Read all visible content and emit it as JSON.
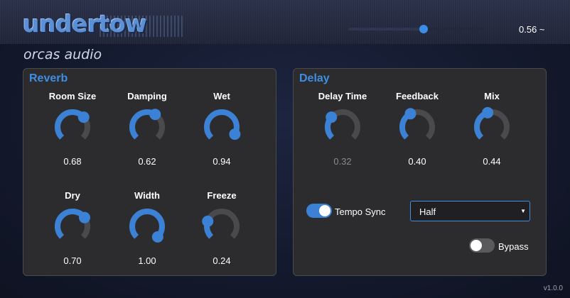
{
  "header": {
    "title": "undertow",
    "subtitle": "orcas audio",
    "master": {
      "value": 0.56,
      "display": "0.56 ~"
    }
  },
  "reverb": {
    "title": "Reverb",
    "knobs": [
      {
        "label": "Room Size",
        "value": 0.68,
        "display": "0.68"
      },
      {
        "label": "Damping",
        "value": 0.62,
        "display": "0.62"
      },
      {
        "label": "Wet",
        "value": 0.94,
        "display": "0.94"
      },
      {
        "label": "Dry",
        "value": 0.7,
        "display": "0.70"
      },
      {
        "label": "Width",
        "value": 1.0,
        "display": "1.00"
      },
      {
        "label": "Freeze",
        "value": 0.24,
        "display": "0.24"
      }
    ]
  },
  "delay": {
    "title": "Delay",
    "knobs": [
      {
        "label": "Delay Time",
        "value": 0.32,
        "display": "0.32",
        "disabled": true
      },
      {
        "label": "Feedback",
        "value": 0.4,
        "display": "0.40"
      },
      {
        "label": "Mix",
        "value": 0.44,
        "display": "0.44"
      }
    ],
    "tempo_sync": {
      "label": "Tempo Sync",
      "on": true
    },
    "division": {
      "value": "Half"
    },
    "bypass": {
      "label": "Bypass",
      "on": false
    }
  },
  "footer": {
    "version": "v1.0.0"
  },
  "colors": {
    "accent": "#3b82d6",
    "track": "#4a4a4c",
    "panel": "#2c2c2e"
  }
}
